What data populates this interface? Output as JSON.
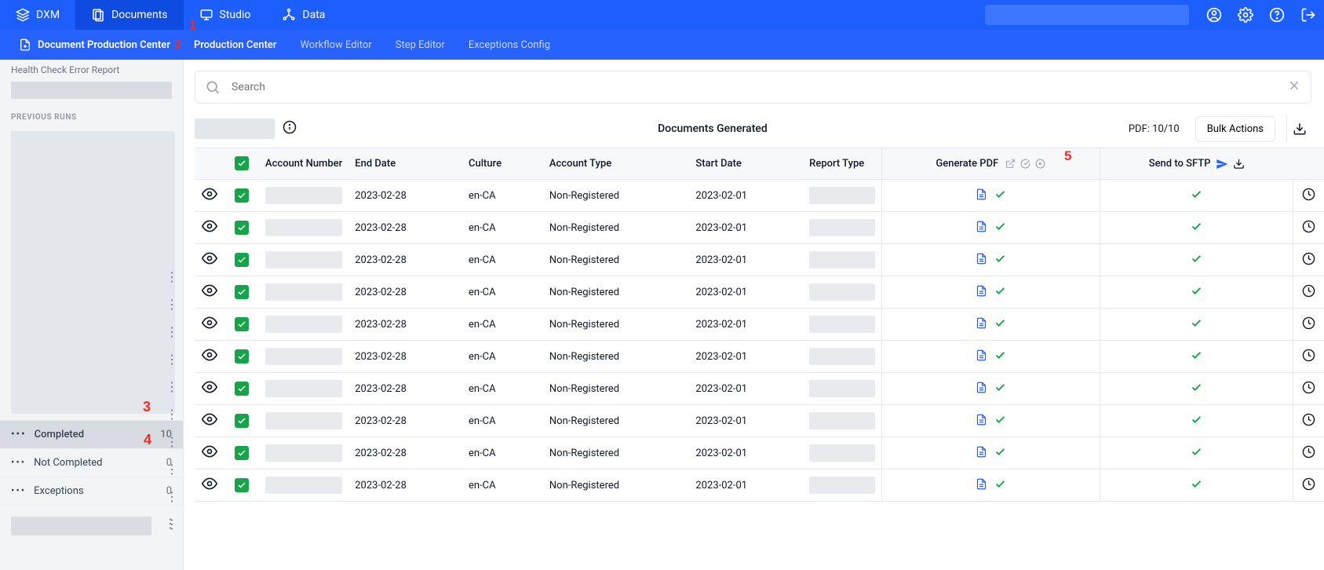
{
  "topnav": {
    "items": [
      {
        "label": "DXM"
      },
      {
        "label": "Documents"
      },
      {
        "label": "Studio"
      },
      {
        "label": "Data"
      }
    ]
  },
  "subnav": {
    "brand": "Document Production Center",
    "tabs": [
      {
        "label": "Production Center"
      },
      {
        "label": "Workflow Editor"
      },
      {
        "label": "Step Editor"
      },
      {
        "label": "Exceptions Config"
      }
    ]
  },
  "sidebar": {
    "cutoff_label": "Health Check Error Report",
    "previous_runs_label": "PREVIOUS RUNS",
    "statuses": [
      {
        "label": "Completed",
        "count": "10"
      },
      {
        "label": "Not Completed",
        "count": "0"
      },
      {
        "label": "Exceptions",
        "count": "0"
      }
    ]
  },
  "main": {
    "search_placeholder": "Search",
    "documents_generated": "Documents Generated",
    "pdf_count": "PDF: 10/10",
    "bulk_actions": "Bulk Actions"
  },
  "table": {
    "headers": {
      "account_number": "Account Number",
      "end_date": "End Date",
      "culture": "Culture",
      "account_type": "Account Type",
      "start_date": "Start Date",
      "report_type": "Report Type",
      "generate_pdf": "Generate PDF",
      "send_to_sftp": "Send to SFTP"
    },
    "rows": [
      {
        "end_date": "2023-02-28",
        "culture": "en-CA",
        "account_type": "Non-Registered",
        "start_date": "2023-02-01"
      },
      {
        "end_date": "2023-02-28",
        "culture": "en-CA",
        "account_type": "Non-Registered",
        "start_date": "2023-02-01"
      },
      {
        "end_date": "2023-02-28",
        "culture": "en-CA",
        "account_type": "Non-Registered",
        "start_date": "2023-02-01"
      },
      {
        "end_date": "2023-02-28",
        "culture": "en-CA",
        "account_type": "Non-Registered",
        "start_date": "2023-02-01"
      },
      {
        "end_date": "2023-02-28",
        "culture": "en-CA",
        "account_type": "Non-Registered",
        "start_date": "2023-02-01"
      },
      {
        "end_date": "2023-02-28",
        "culture": "en-CA",
        "account_type": "Non-Registered",
        "start_date": "2023-02-01"
      },
      {
        "end_date": "2023-02-28",
        "culture": "en-CA",
        "account_type": "Non-Registered",
        "start_date": "2023-02-01"
      },
      {
        "end_date": "2023-02-28",
        "culture": "en-CA",
        "account_type": "Non-Registered",
        "start_date": "2023-02-01"
      },
      {
        "end_date": "2023-02-28",
        "culture": "en-CA",
        "account_type": "Non-Registered",
        "start_date": "2023-02-01"
      },
      {
        "end_date": "2023-02-28",
        "culture": "en-CA",
        "account_type": "Non-Registered",
        "start_date": "2023-02-01"
      }
    ]
  },
  "markers": {
    "m1": "1",
    "m2": "2",
    "m3": "3",
    "m4": "4",
    "m5": "5"
  }
}
